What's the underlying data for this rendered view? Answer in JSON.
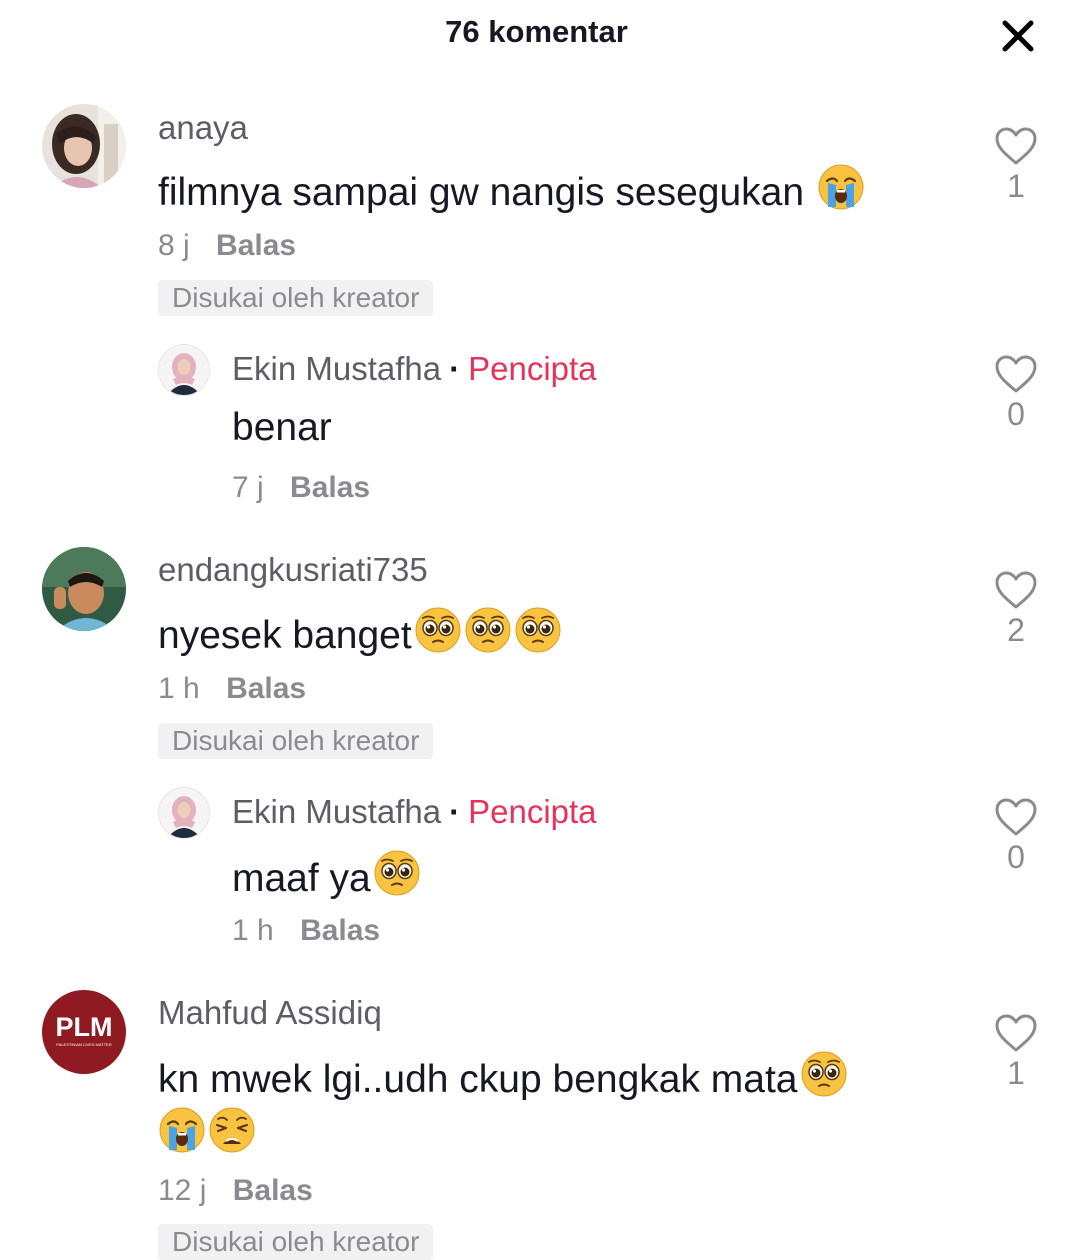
{
  "header": {
    "title": "76 komentar"
  },
  "comments": [
    {
      "username": "anaya",
      "text": "filmnya sampai gw nangis sesegukan",
      "emojis": [
        "crying-face"
      ],
      "time": "8 j",
      "reply_label": "Balas",
      "liked_badge": "Disukai oleh kreator",
      "likes": "1",
      "reply": {
        "username": "Ekin Mustafha",
        "separator": "·",
        "creator_label": "Pencipta",
        "text": "benar",
        "time": "7 j",
        "reply_label": "Balas",
        "likes": "0"
      }
    },
    {
      "username": "endangkusriati735",
      "text": "nyesek banget",
      "emojis": [
        "pleading-face",
        "pleading-face",
        "pleading-face"
      ],
      "time": "1 h",
      "reply_label": "Balas",
      "liked_badge": "Disukai oleh kreator",
      "likes": "2",
      "reply": {
        "username": "Ekin Mustafha",
        "separator": "·",
        "creator_label": "Pencipta",
        "text": "maaf ya",
        "emojis": [
          "pleading-face"
        ],
        "time": "1 h",
        "reply_label": "Balas",
        "likes": "0"
      }
    },
    {
      "username": "Mahfud Assidiq",
      "avatar_text": "PLM",
      "avatar_subtext": "PALESTINIAN LIVES MATTER",
      "text": "kn mwek lgi..udh ckup bengkak mata",
      "emojis": [
        "pleading-face"
      ],
      "text_line2_emojis": [
        "crying-face",
        "weary-face"
      ],
      "time": "12 j",
      "reply_label": "Balas",
      "liked_badge": "Disukai oleh kreator",
      "likes": "1"
    }
  ],
  "colors": {
    "creator_accent": "#e8325a",
    "secondary_text": "#8a8b91",
    "primary_text": "#161823",
    "badge_bg": "#f1f1f2",
    "plm_avatar_bg": "#8f1a21"
  }
}
